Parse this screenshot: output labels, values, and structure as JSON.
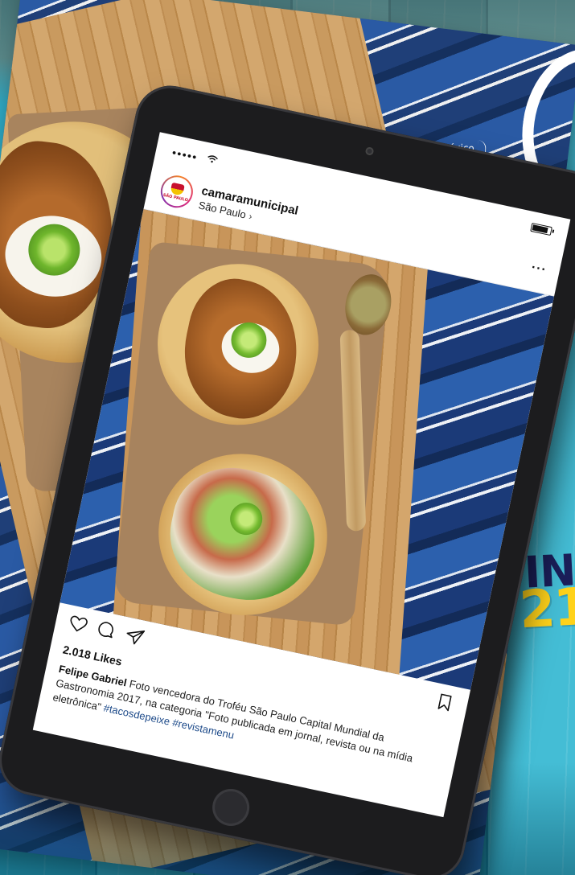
{
  "magazine": {
    "section_label": "méxico"
  },
  "promo": {
    "line1": "INS",
    "line2": "21"
  },
  "status_bar": {
    "signal": "●●●●●"
  },
  "post": {
    "username": "camaramunicipal",
    "location": "São Paulo",
    "avatar_text": "SÃO PAULO",
    "likes": "2.018 Likes",
    "caption_user": "Felipe Gabriel",
    "caption_text": "Foto vencedora do Troféu São Paulo Capital Mundial da Gastronomia 2017, na categoria \"Foto publicada em jornal, revista ou na mídia eletrônica\"",
    "hashtags": "#tacosdepeixe #revistamenu"
  },
  "icons": {
    "heart": "heart-icon",
    "comment": "comment-icon",
    "share": "share-icon",
    "bookmark": "bookmark-icon",
    "more": "more-icon",
    "wifi": "wifi-icon",
    "battery": "battery-icon"
  },
  "colors": {
    "background_blue": "#3fb7cf",
    "promo_navy": "#1b1f5a",
    "promo_yellow": "#ffd21a",
    "hashtag_blue": "#1e4b8a",
    "tablet_frame": "#1c1c1e"
  }
}
